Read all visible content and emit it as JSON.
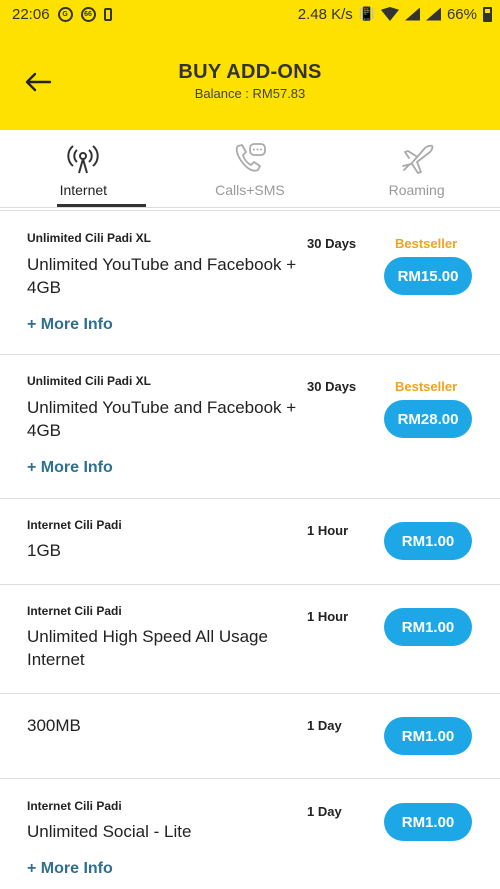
{
  "status_bar": {
    "time": "22:06",
    "icon_g": "G",
    "icon_66": "66",
    "speed": "2.48 K/s",
    "battery": "66%"
  },
  "header": {
    "title": "BUY ADD-ONS",
    "balance": "Balance : RM57.83"
  },
  "tabs": [
    {
      "label": "Internet",
      "icon": "signal-tower-icon",
      "active": true
    },
    {
      "label": "Calls+SMS",
      "icon": "phone-chat-icon",
      "active": false
    },
    {
      "label": "Roaming",
      "icon": "airplane-icon",
      "active": false
    }
  ],
  "colors": {
    "header_bg": "#FFE100",
    "price_button": "#1EA7E6",
    "bestseller": "#F0A31F",
    "more_info": "#2F6F8F"
  },
  "items": [
    {
      "category": "Unlimited Cili Padi XL",
      "name": "Unlimited YouTube and Facebook + 4GB",
      "duration": "30 Days",
      "badge": "Bestseller",
      "price": "RM15.00",
      "more": "+ More Info"
    },
    {
      "category": "Unlimited Cili Padi XL",
      "name": "Unlimited YouTube and Facebook + 4GB",
      "duration": "30 Days",
      "badge": "Bestseller",
      "price": "RM28.00",
      "more": "+ More Info"
    },
    {
      "category": "Internet Cili Padi",
      "name": "1GB",
      "duration": "1 Hour",
      "price": "RM1.00"
    },
    {
      "category": "Internet Cili Padi",
      "name": "Unlimited High Speed All Usage Internet",
      "duration": "1 Hour",
      "price": "RM1.00"
    },
    {
      "name": "300MB",
      "duration": "1 Day",
      "price": "RM1.00"
    },
    {
      "category": "Internet Cili Padi",
      "name": "Unlimited Social - Lite",
      "duration": "1 Day",
      "price": "RM1.00",
      "more": "+ More Info"
    }
  ]
}
